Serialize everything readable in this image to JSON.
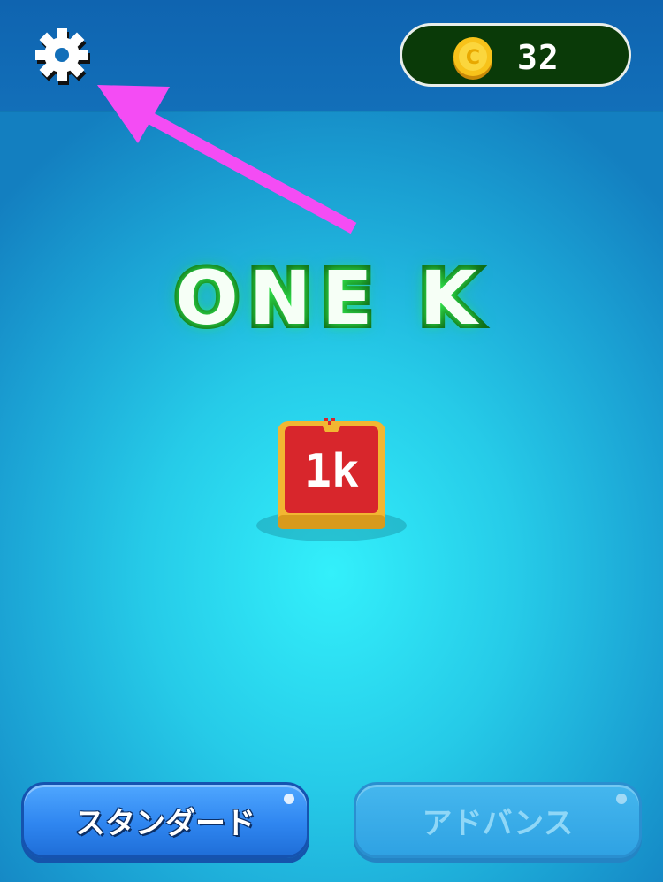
{
  "header": {
    "settings_icon": "gear-icon",
    "coin_icon": "coin-icon",
    "coins": "32"
  },
  "game": {
    "title": "ONE K",
    "logo_text": "1k"
  },
  "buttons": {
    "standard_label": "スタンダード",
    "advanced_label": "アドバンス"
  },
  "annotation": {
    "arrow_icon": "arrow-icon",
    "arrow_color": "#f44cf4"
  },
  "colors": {
    "topbar": "#0f64b0",
    "background_center": "#33f0fb",
    "title_glow": "#3cff5a",
    "logo_red": "#d8262c",
    "logo_gold": "#f2b632",
    "standard_button": "#2f86f0",
    "advanced_button": "#2fa2e3"
  }
}
